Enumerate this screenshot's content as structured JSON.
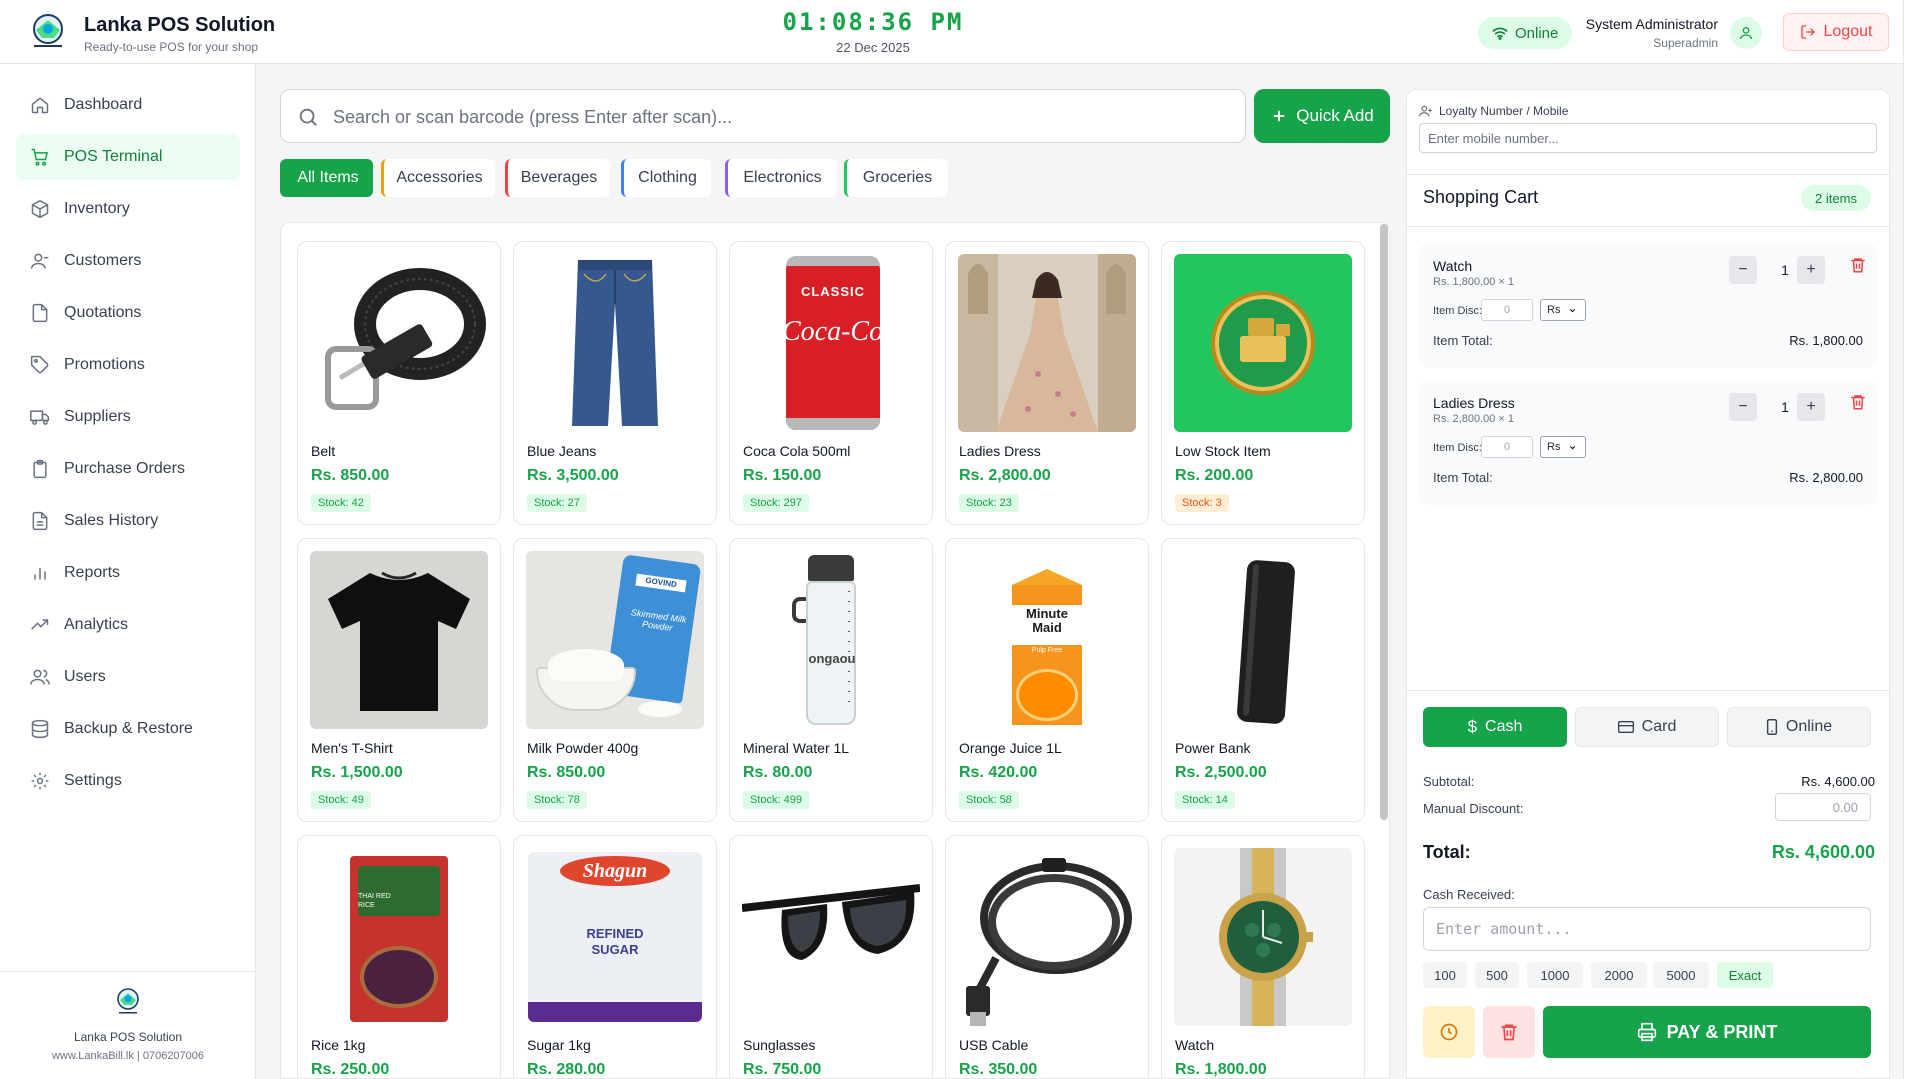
{
  "app": {
    "title": "Lanka POS Solution",
    "subtitle": "Ready-to-use POS for your shop",
    "logo_text": "LankaPOS Solution"
  },
  "header": {
    "time": "01:08:36 PM",
    "date": "22 Dec 2025",
    "status": "Online",
    "user_name": "System Administrator",
    "user_role": "Superadmin",
    "logout_label": "Logout"
  },
  "sidebar": {
    "items": [
      {
        "label": "Dashboard",
        "icon": "home-icon"
      },
      {
        "label": "POS Terminal",
        "icon": "cart-icon",
        "active": true
      },
      {
        "label": "Inventory",
        "icon": "box-icon"
      },
      {
        "label": "Customers",
        "icon": "user-icon"
      },
      {
        "label": "Quotations",
        "icon": "file-icon"
      },
      {
        "label": "Promotions",
        "icon": "tag-icon"
      },
      {
        "label": "Suppliers",
        "icon": "truck-icon"
      },
      {
        "label": "Purchase Orders",
        "icon": "clipboard-icon"
      },
      {
        "label": "Sales History",
        "icon": "document-icon"
      },
      {
        "label": "Reports",
        "icon": "bar-chart-icon"
      },
      {
        "label": "Analytics",
        "icon": "trending-icon"
      },
      {
        "label": "Users",
        "icon": "users-icon"
      },
      {
        "label": "Backup & Restore",
        "icon": "database-icon"
      },
      {
        "label": "Settings",
        "icon": "gear-icon"
      }
    ],
    "footer": {
      "name": "Lanka POS Solution",
      "contact": "www.LankaBill.lk | 0706207006"
    }
  },
  "search": {
    "placeholder": "Search or scan barcode (press Enter after scan)...",
    "value": ""
  },
  "quick_add_label": "Quick Add",
  "categories": [
    {
      "label": "All Items",
      "active": true,
      "color": "#16a34a"
    },
    {
      "label": "Accessories",
      "color": "#f59e0b"
    },
    {
      "label": "Beverages",
      "color": "#ef4444"
    },
    {
      "label": "Clothing",
      "color": "#3b82f6"
    },
    {
      "label": "Electronics",
      "color": "#8b5cf6"
    },
    {
      "label": "Groceries",
      "color": "#22c55e"
    }
  ],
  "products": [
    {
      "name": "Belt",
      "price": "Rs. 850.00",
      "stock": "Stock: 42"
    },
    {
      "name": "Blue Jeans",
      "price": "Rs. 3,500.00",
      "stock": "Stock: 27"
    },
    {
      "name": "Coca Cola 500ml",
      "price": "Rs. 150.00",
      "stock": "Stock: 297"
    },
    {
      "name": "Ladies Dress",
      "price": "Rs. 2,800.00",
      "stock": "Stock: 23"
    },
    {
      "name": "Low Stock Item",
      "price": "Rs. 200.00",
      "stock": "Stock: 3",
      "low": true
    },
    {
      "name": "Men's T-Shirt",
      "price": "Rs. 1,500.00",
      "stock": "Stock: 49"
    },
    {
      "name": "Milk Powder 400g",
      "price": "Rs. 850.00",
      "stock": "Stock: 78"
    },
    {
      "name": "Mineral Water 1L",
      "price": "Rs. 80.00",
      "stock": "Stock: 499"
    },
    {
      "name": "Orange Juice 1L",
      "price": "Rs. 420.00",
      "stock": "Stock: 58"
    },
    {
      "name": "Power Bank",
      "price": "Rs. 2,500.00",
      "stock": "Stock: 14"
    },
    {
      "name": "Rice 1kg",
      "price": "Rs. 250.00",
      "stock": ""
    },
    {
      "name": "Sugar 1kg",
      "price": "Rs. 280.00",
      "stock": ""
    },
    {
      "name": "Sunglasses",
      "price": "Rs. 750.00",
      "stock": ""
    },
    {
      "name": "USB Cable",
      "price": "Rs. 350.00",
      "stock": ""
    },
    {
      "name": "Watch",
      "price": "Rs. 1,800.00",
      "stock": ""
    }
  ],
  "product_image_text": {
    "coke_brand": "CLASSIC",
    "coke_logo": "Coca-Cola",
    "milk_brand": "GOVIND",
    "milk_label": "Skimmed Milk Powder",
    "juice_brand": "Minute Maid",
    "juice_sub": "Pulp Free",
    "water_text": "ongaou",
    "rice_label": "THAI RED RICE",
    "sugar_brand": "Shagun",
    "sugar_label": "REFINED SUGAR"
  },
  "loyalty": {
    "label": "Loyalty Number / Mobile",
    "placeholder": "Enter mobile number..."
  },
  "cart": {
    "title": "Shopping Cart",
    "count": "2 items",
    "items": [
      {
        "name": "Watch",
        "unit": "Rs. 1,800.00 × 1",
        "qty": "1",
        "disc_label": "Item Disc:",
        "disc": "0",
        "disc_type": "Rs",
        "total_label": "Item Total:",
        "total": "Rs. 1,800.00"
      },
      {
        "name": "Ladies Dress",
        "unit": "Rs. 2,800.00 × 1",
        "qty": "1",
        "disc_label": "Item Disc:",
        "disc": "0",
        "disc_type": "Rs",
        "total_label": "Item Total:",
        "total": "Rs. 2,800.00"
      }
    ]
  },
  "payment": {
    "methods": [
      {
        "label": "Cash",
        "active": true
      },
      {
        "label": "Card"
      },
      {
        "label": "Online"
      }
    ],
    "subtotal_label": "Subtotal:",
    "subtotal": "Rs. 4,600.00",
    "manual_discount_label": "Manual Discount:",
    "manual_discount": "0.00",
    "total_label": "Total:",
    "total": "Rs. 4,600.00",
    "cash_received_label": "Cash Received:",
    "cash_placeholder": "Enter amount...",
    "quick_amounts": [
      "100",
      "500",
      "1000",
      "2000",
      "5000",
      "Exact"
    ],
    "pay_print_label": "PAY & PRINT"
  },
  "colors": {
    "primary": "#16a34a",
    "danger": "#ef4444",
    "warning": "#f59e0b"
  }
}
